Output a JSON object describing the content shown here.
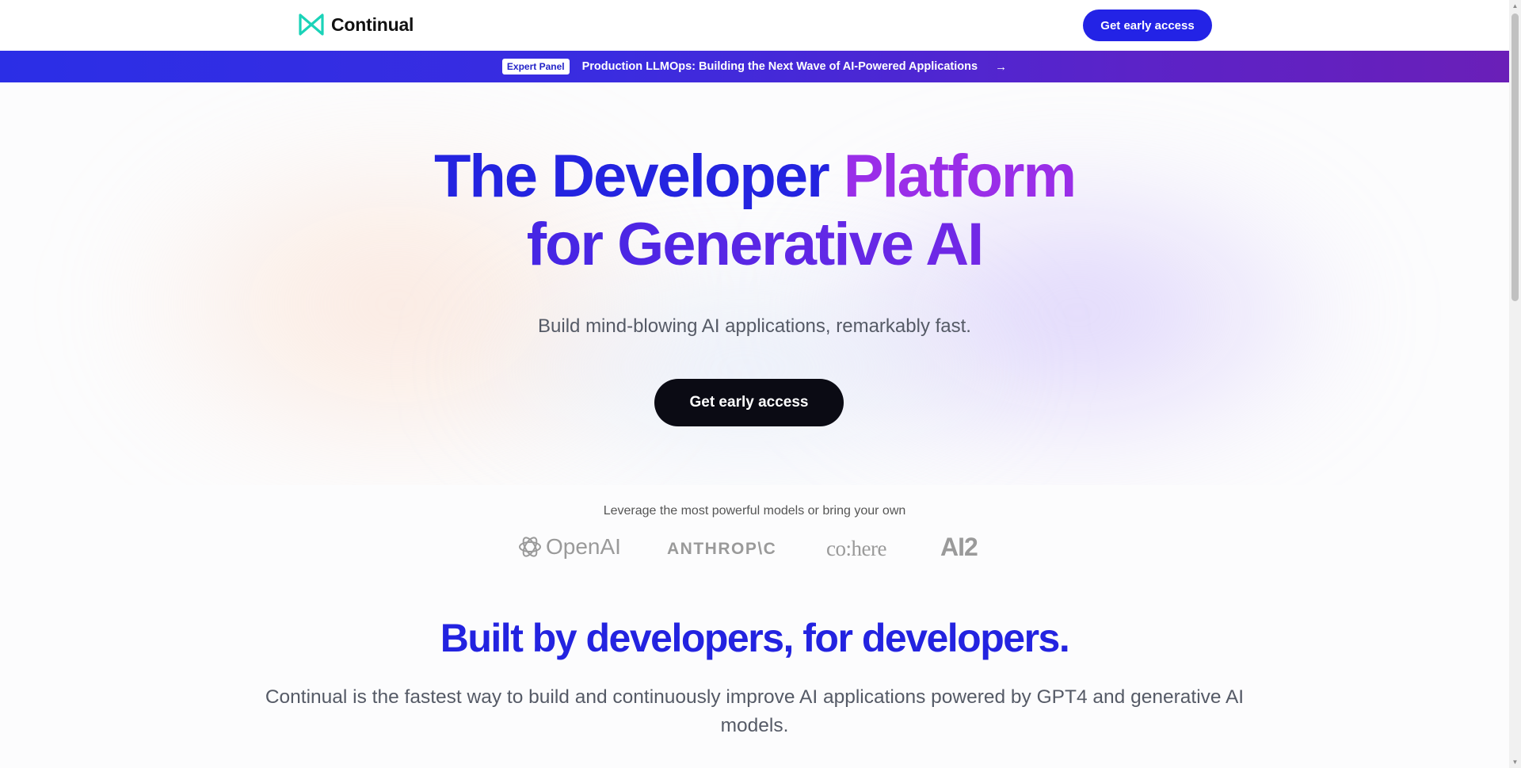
{
  "header": {
    "brand": "Continual",
    "cta_label": "Get early access"
  },
  "banner": {
    "badge": "Expert Panel",
    "text": "Production LLMOps: Building the Next Wave of AI-Powered Applications",
    "arrow": "→"
  },
  "hero": {
    "title_line1_a": "The Developer ",
    "title_line1_b": "Platform",
    "title_line2": "for Generative AI",
    "subtitle": "Build mind-blowing AI applications, remarkably fast.",
    "cta_label": "Get early access"
  },
  "models": {
    "label": "Leverage the most powerful models or bring your own",
    "logos": [
      "OpenAI",
      "ANTHROP\\C",
      "co:here",
      "AI2"
    ]
  },
  "built": {
    "title": "Built by developers, for developers.",
    "subtitle": "Continual is the fastest way to build and continuously improve AI applications powered by GPT4 and generative AI models."
  },
  "colors": {
    "brand_blue": "#2323e6",
    "brand_purple": "#a12ee6",
    "logo_teal": "#1ad3b8",
    "dark_button": "#0b0b14"
  }
}
